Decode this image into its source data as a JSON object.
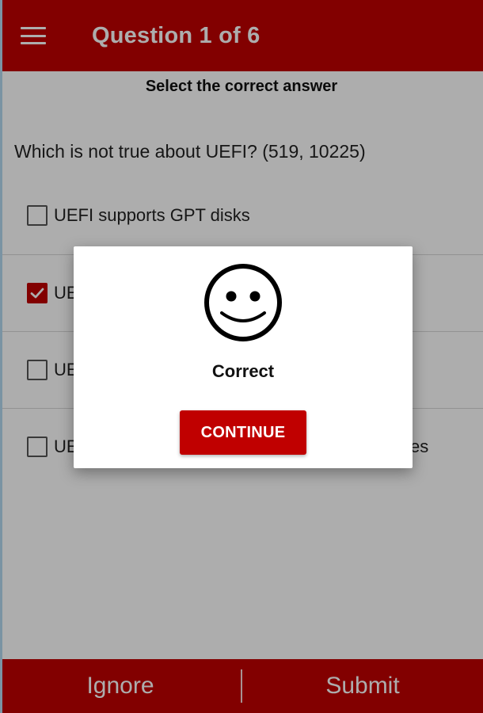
{
  "appbar": {
    "title": "Question 1 of 6",
    "menu_icon": "menu-icon",
    "color": "#c00000"
  },
  "quiz": {
    "instruction": "Select the correct answer",
    "question": "Which is not true about UEFI? (519, 10225)",
    "options": [
      {
        "label": "UEFI supports GPT disks",
        "checked": false
      },
      {
        "label": "UE",
        "checked": true
      },
      {
        "label": "UE",
        "checked": false
      },
      {
        "label": "UE",
        "checked": false,
        "trailing": "es"
      }
    ]
  },
  "dialog": {
    "icon": "smiley-face-icon",
    "result": "Correct",
    "button": "CONTINUE"
  },
  "bottombar": {
    "ignore": "Ignore",
    "submit": "Submit"
  }
}
